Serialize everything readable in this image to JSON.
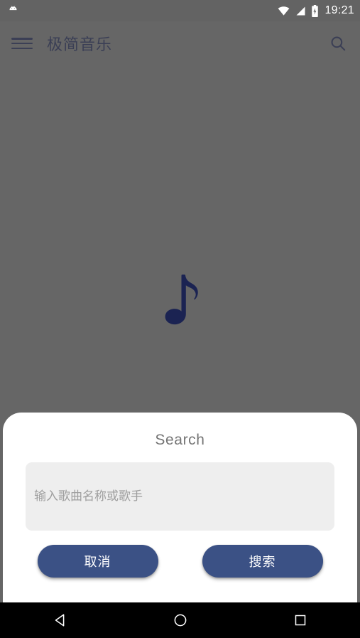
{
  "status_bar": {
    "notification_icon": "android-robot-icon",
    "wifi_icon": "wifi-icon",
    "signal_icon": "cellular-signal-icon",
    "battery_icon": "battery-charging-icon",
    "time": "19:21"
  },
  "app_bar": {
    "menu_icon": "hamburger-menu-icon",
    "title": "极简音乐",
    "search_icon": "search-icon"
  },
  "content": {
    "placeholder_icon": "music-note-icon"
  },
  "dialog": {
    "title": "Search",
    "input_value": "",
    "input_placeholder": "输入歌曲名称或歌手",
    "cancel_label": "取消",
    "confirm_label": "搜索"
  },
  "nav_bar": {
    "back_icon": "back-triangle-icon",
    "home_icon": "home-circle-icon",
    "recents_icon": "recents-square-icon"
  },
  "colors": {
    "scrim": "#666666",
    "status_bar": "#636363",
    "accent": "#3b5185",
    "brand_dark": "#1b2352",
    "input_bg": "#eeeeee",
    "dialog_bg": "#ffffff",
    "nav_bar": "#000000"
  }
}
